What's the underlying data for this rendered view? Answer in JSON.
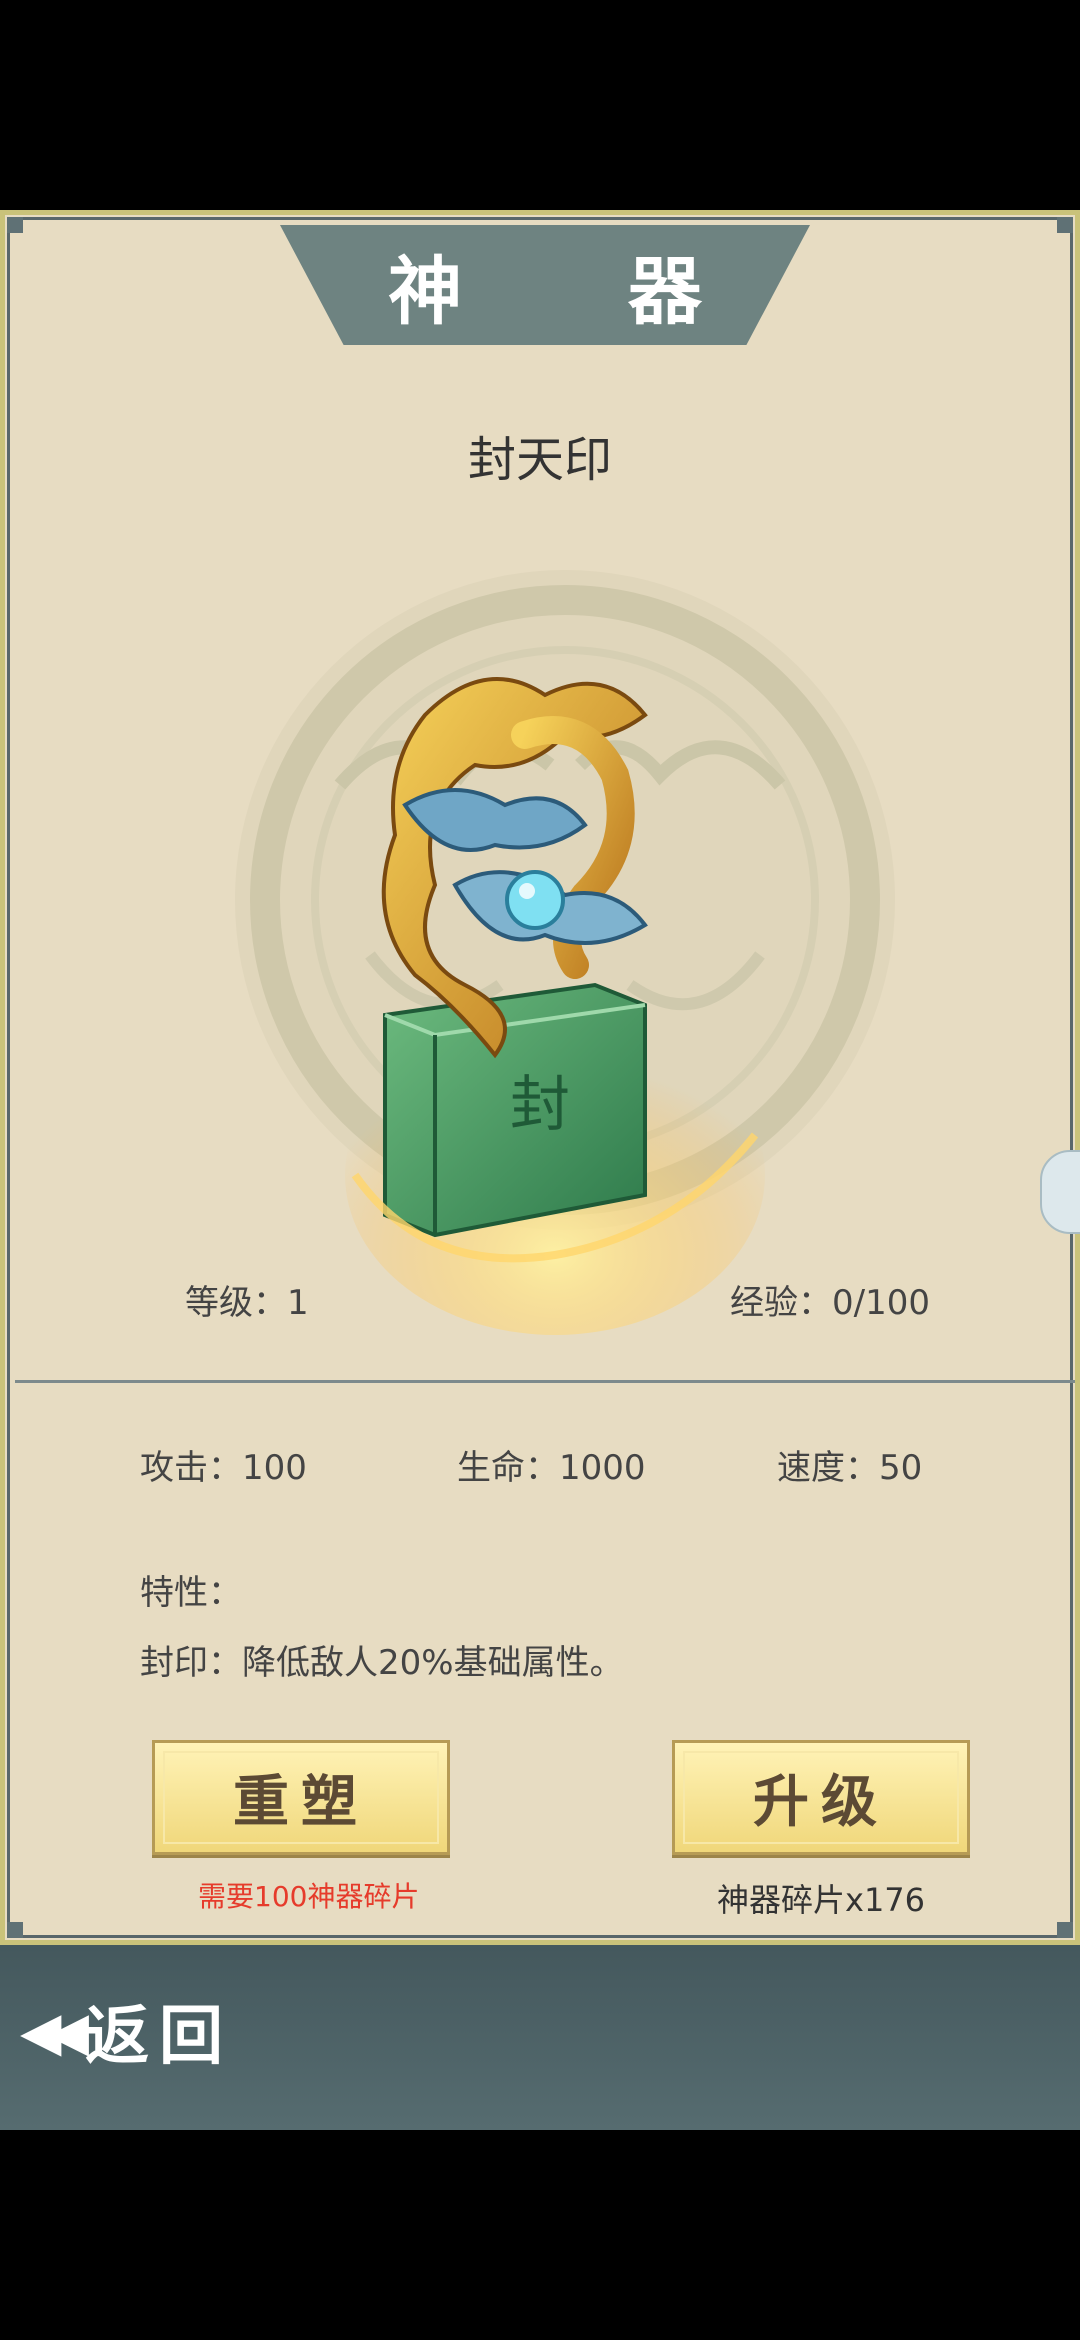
{
  "screen_title": "神 器",
  "artifact": {
    "name": "封天印",
    "seal_glyph": "封",
    "level_label": "等级：1",
    "exp_label": "经验：0/100"
  },
  "stats": {
    "attack": "攻击：100",
    "hp": "生命：1000",
    "speed": "速度：50"
  },
  "traits": {
    "header": "特性：",
    "desc": "封印：降低敌人20%基础属性。"
  },
  "buttons": {
    "reforge_label": "重塑",
    "reforge_cost": "需要100神器碎片",
    "upgrade_label": "升级",
    "upgrade_info": "神器碎片x176"
  },
  "footer": {
    "back_label": "返回",
    "back_icon": "double-left-arrow-icon"
  },
  "colors": {
    "panel_bg": "#e7dcc2",
    "banner": "#6e8381",
    "button_gold": "#f0d77a",
    "cost_red": "#e63b2b",
    "footer": "#4d6267"
  }
}
